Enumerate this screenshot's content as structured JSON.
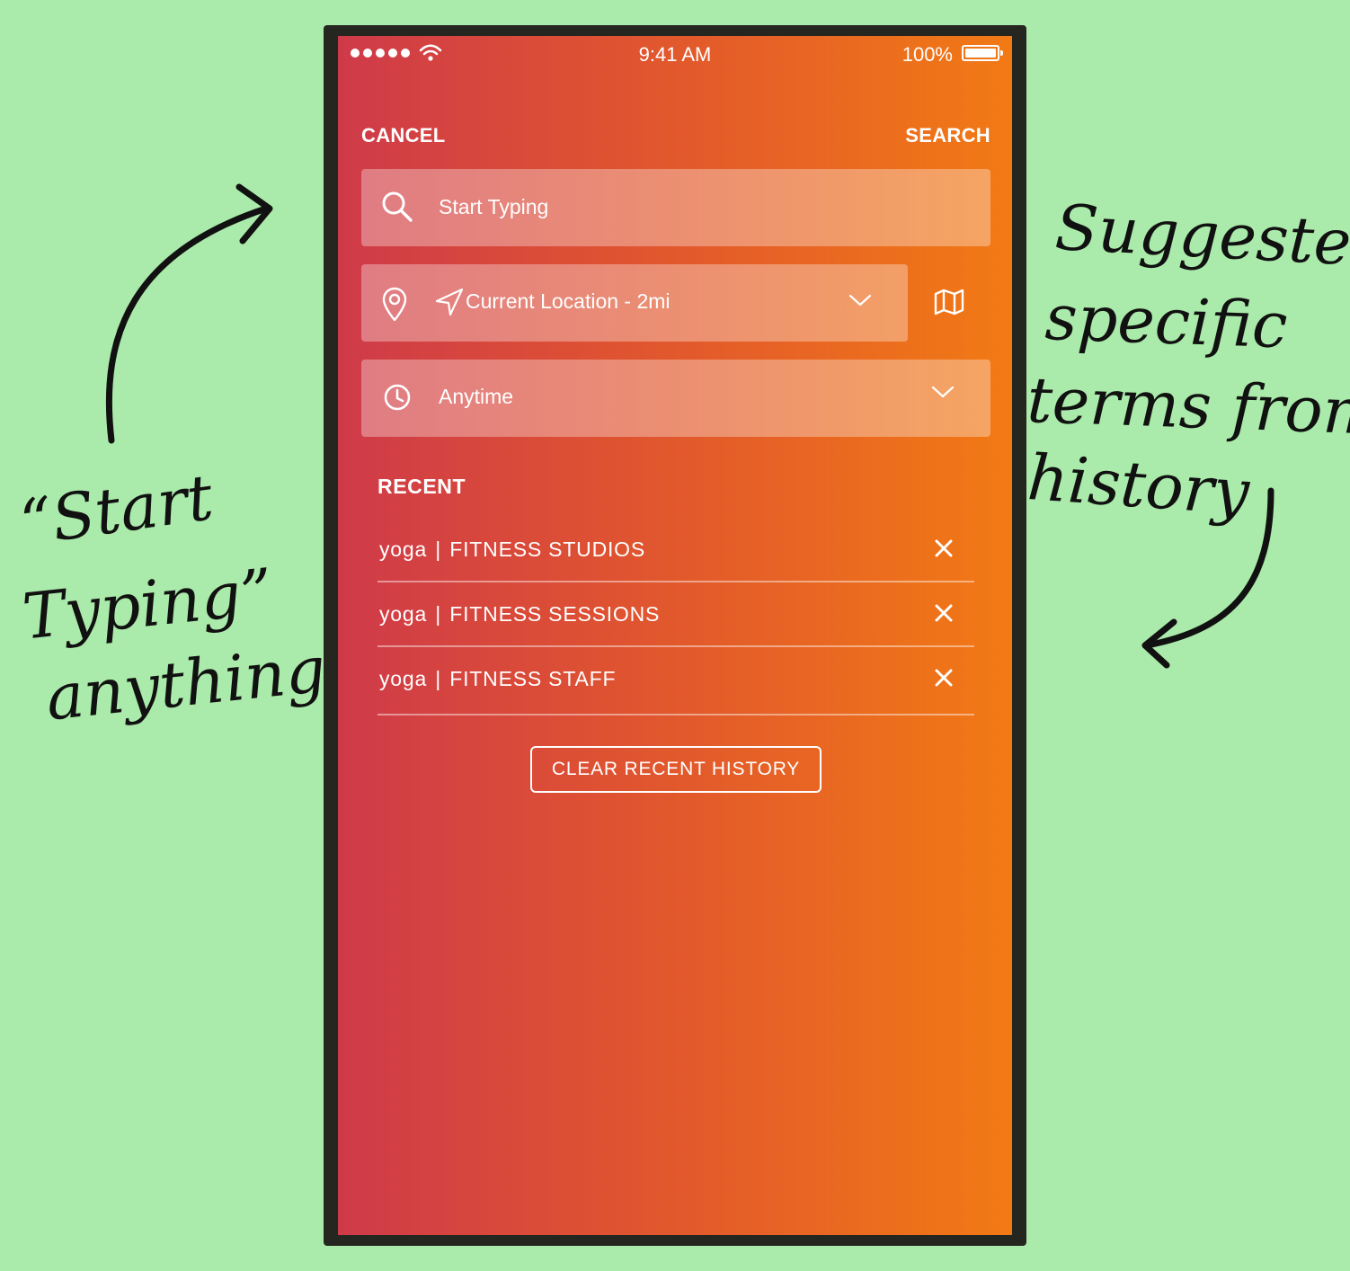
{
  "annotations": {
    "left_lines": [
      "“Start",
      "Typing”",
      "anything"
    ],
    "right_lines": [
      "Suggested",
      "specific",
      "terms from",
      "history"
    ]
  },
  "status_bar": {
    "time": "9:41 AM",
    "battery": "100%"
  },
  "nav": {
    "cancel": "CANCEL",
    "search": "SEARCH"
  },
  "search": {
    "placeholder": "Start Typing",
    "value": ""
  },
  "location": {
    "value": "Current Location - 2mi"
  },
  "time_filter": {
    "value": "Anytime"
  },
  "recent": {
    "heading": "RECENT",
    "separator": "|",
    "items": [
      {
        "term": "yoga",
        "category": "FITNESS STUDIOS"
      },
      {
        "term": "yoga",
        "category": "FITNESS SESSIONS"
      },
      {
        "term": "yoga",
        "category": "FITNESS STAFF"
      }
    ],
    "clear_label": "CLEAR RECENT HISTORY"
  },
  "colors": {
    "background": "#aaeaaa",
    "gradient_start": "#cf3a49",
    "gradient_end": "#f27a14",
    "phone_frame": "#262621"
  },
  "icons": [
    "search-icon",
    "map-pin-icon",
    "navigation-arrow-icon",
    "chevron-down-icon",
    "map-icon",
    "clock-icon",
    "close-icon",
    "wifi-icon",
    "battery-icon"
  ]
}
